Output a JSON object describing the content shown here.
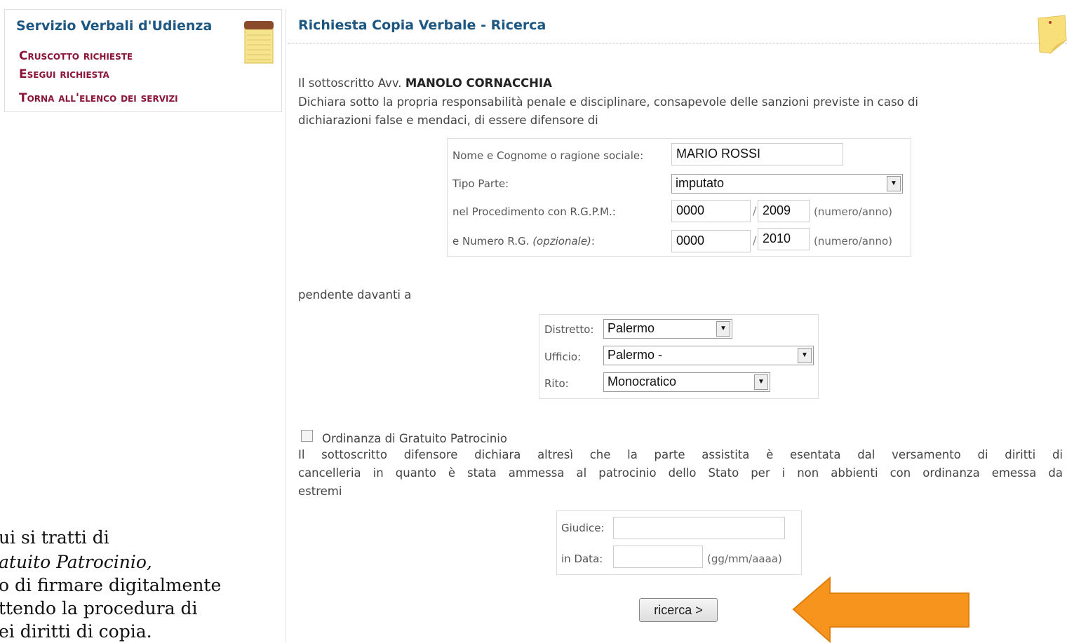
{
  "sidebar": {
    "title": "Servizio Verbali d'Udienza",
    "links": [
      "Cruscotto richieste",
      "Esegui richiesta",
      "Torna all'elenco dei servizi"
    ]
  },
  "main": {
    "title": "Richiesta Copia Verbale - Ricerca",
    "declarant_prefix": "Il sottoscritto Avv.",
    "declarant_name": "MANOLO CORNACCHIA",
    "declaration_line1": "Dichiara sotto la propria responsabilità penale e disciplinare, consapevole delle sanzioni previste in caso di",
    "declaration_line2": "dichiarazioni false e mendaci, di essere difensore di"
  },
  "party_form": {
    "name_label": "Nome e Cognome o ragione sociale:",
    "name_value": "MARIO ROSSI",
    "tipo_label": "Tipo Parte:",
    "tipo_value": "imputato",
    "rgpm_label": "nel Procedimento con R.G.P.M.:",
    "rgpm_numero": "0000",
    "rgpm_anno": "2009",
    "rg_label_prefix": "e Numero R.G.",
    "rg_label_optional": "(opzionale)",
    "rg_label_suffix": ":",
    "rg_numero": "0000",
    "rg_anno": "2010",
    "numero_anno_hint": "(numero/anno)",
    "slash": "/"
  },
  "pendente": "pendente davanti a",
  "court_form": {
    "distretto_label": "Distretto:",
    "distretto_value": "Palermo",
    "ufficio_label": "Ufficio:",
    "ufficio_value": "Palermo -",
    "rito_label": "Rito:",
    "rito_value": "Monocratico"
  },
  "gratuito": {
    "checkbox_label": "Ordinanza di Gratuito Patrocinio",
    "line1": "Il sottoscritto difensore dichiara altresì che la parte assistita è esentata dal versamento di diritti di",
    "line2": "cancelleria in quanto è stata ammessa al patrocinio dello Stato per i non abbienti con ordinanza emessa da",
    "line3": "estremi"
  },
  "ordinanza_form": {
    "giudice_label": "Giudice:",
    "giudice_value": "",
    "data_label": "in Data:",
    "data_value": "",
    "data_hint": "(gg/mm/aaaa)"
  },
  "search_button": "ricerca >",
  "overlay_text": [
    "ui si tratti di",
    "atuito Patrocinio,",
    "o di firmare digitalmente",
    "ttendo la procedura di",
    "ei diritti di copia."
  ],
  "colors": {
    "title_blue": "#1d5680",
    "link_red": "#8a1538",
    "arrow_orange": "#f7941d"
  },
  "icons": [
    "notepad-icon",
    "sticky-note-icon",
    "arrow-icon",
    "select-arrow-icon"
  ]
}
